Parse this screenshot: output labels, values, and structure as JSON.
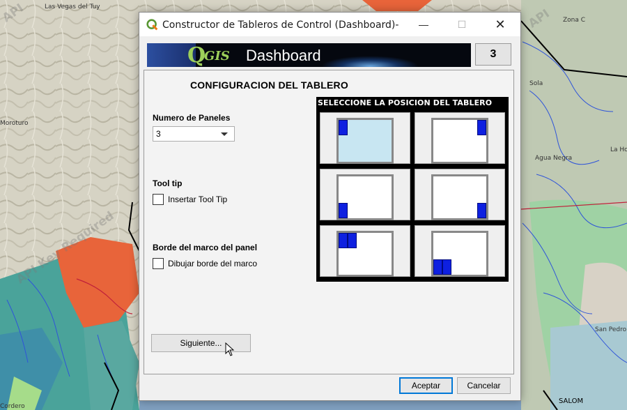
{
  "map": {
    "labels": [
      "Las Vegas del Tuy",
      "Zona C",
      "Moroturo",
      "Sola",
      "La Hoya",
      "Agua Negra",
      "SALOM",
      "Cordero",
      "San Pedro"
    ],
    "watermark": "API Key Required",
    "watermark_top": "API",
    "watermark_right": "API"
  },
  "dialog": {
    "title": "Constructor de Tableros de Control (Dashboard)-",
    "window_buttons": {
      "minimize": "—",
      "maximize": "☐",
      "close": "✕"
    },
    "banner": {
      "q": "Q",
      "gis": "GIS",
      "text": "Dashboard"
    },
    "panel_count": "3",
    "config_title": "CONFIGURACION DEL  TABLERO",
    "num_panels": {
      "label": "Numero de Paneles",
      "value": "3"
    },
    "tooltip": {
      "label": "Tool tip",
      "checkbox_label": "Insertar Tool Tip",
      "checked": false
    },
    "border": {
      "label": "Borde del marco del panel",
      "checkbox_label": "Dibujar borde del marco",
      "checked": false
    },
    "next_button": "Siguiente...",
    "position": {
      "title": "SELECCIONE LA POSICION DEL TABLERO",
      "options": [
        "top-left",
        "top-right",
        "bottom-left",
        "bottom-right",
        "top-left-double",
        "bottom-left-double"
      ],
      "selected": "top-left"
    },
    "accept_button": "Aceptar",
    "cancel_button": "Cancelar"
  },
  "colors": {
    "accent_blue": "#0e20e0",
    "selected_bg": "#c8e6f2",
    "focus_border": "#0078d7"
  }
}
